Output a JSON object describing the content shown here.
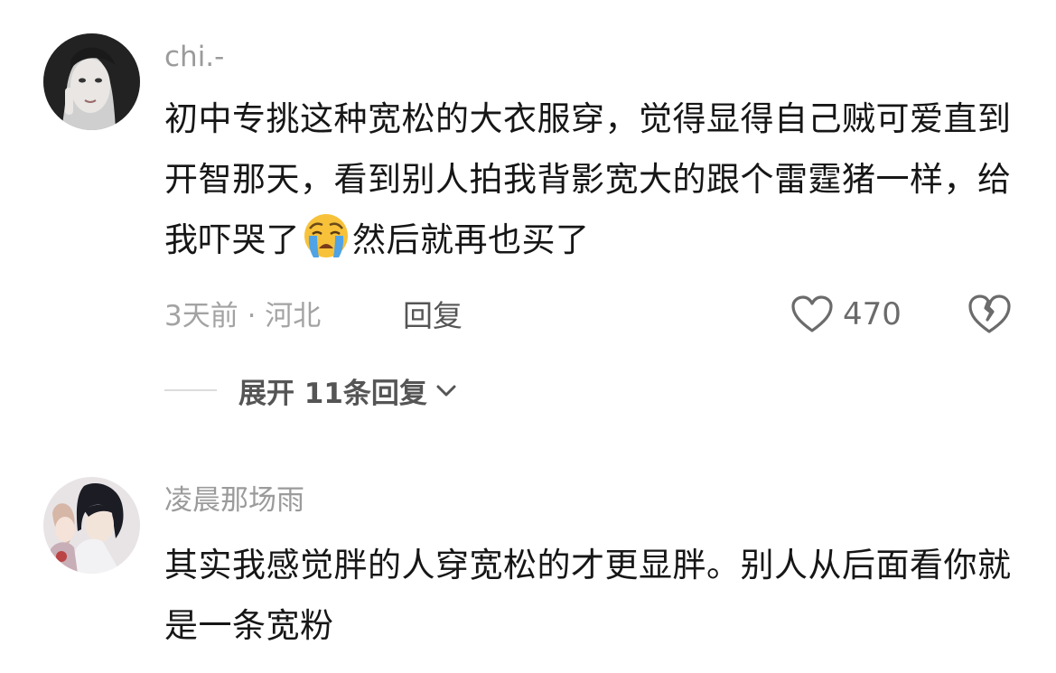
{
  "comments": [
    {
      "username": "chi.-",
      "text_before_emoji": "初中专挑这种宽松的大衣服穿，觉得显得自己贼可爱直到开智那天，看到别人拍我背影宽大的跟个雷霆猪一样，给我吓哭了",
      "emoji_icon": "loudly-crying-face-icon",
      "text_after_emoji": "然后就再也买了",
      "meta": "3天前 · 河北",
      "reply_label": "回复",
      "likes": "470",
      "expand_replies_label": "展开 11条回复"
    },
    {
      "username": "凌晨那场雨",
      "text": "其实我感觉胖的人穿宽松的才更显胖。别人从后面看你就是一条宽粉"
    }
  ],
  "colors": {
    "username": "#9b9b9b",
    "body_text": "#161616",
    "meta": "#a3a3a3",
    "action": "#555555"
  }
}
